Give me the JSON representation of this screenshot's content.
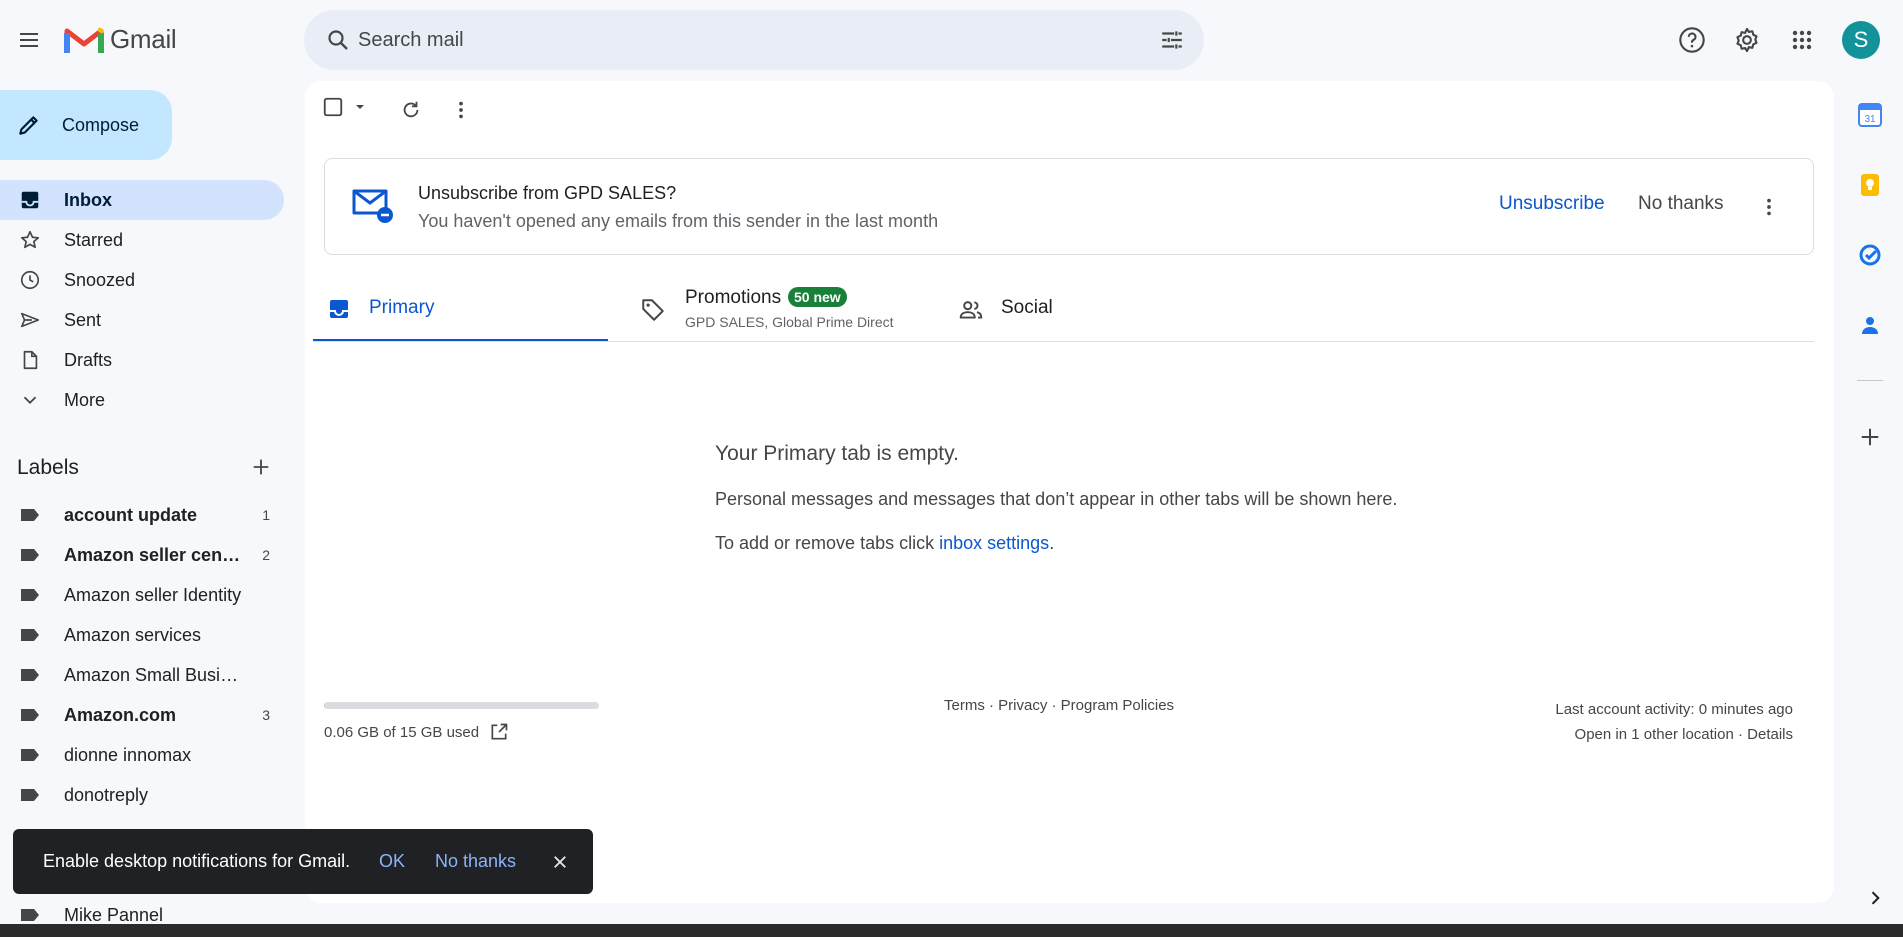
{
  "app": {
    "name": "Gmail"
  },
  "search": {
    "placeholder": "Search mail"
  },
  "user": {
    "initial": "S"
  },
  "compose": {
    "label": "Compose"
  },
  "nav": [
    {
      "label": "Inbox",
      "active": true
    },
    {
      "label": "Starred"
    },
    {
      "label": "Snoozed"
    },
    {
      "label": "Sent"
    },
    {
      "label": "Drafts"
    },
    {
      "label": "More"
    }
  ],
  "labels": {
    "title": "Labels",
    "items": [
      {
        "label": "account update",
        "count": "1",
        "bold": true
      },
      {
        "label": "Amazon seller cent…",
        "count": "2",
        "bold": true
      },
      {
        "label": "Amazon seller Identity",
        "count": ""
      },
      {
        "label": "Amazon services",
        "count": ""
      },
      {
        "label": "Amazon Small Business",
        "count": ""
      },
      {
        "label": "Amazon.com",
        "count": "3",
        "bold": true
      },
      {
        "label": "dionne innomax",
        "count": ""
      },
      {
        "label": "donotreply",
        "count": ""
      },
      {
        "label": "Mike Pannel",
        "count": ""
      }
    ]
  },
  "unsubscribe": {
    "title": "Unsubscribe from GPD SALES?",
    "subtitle": "You haven't opened any emails from this sender in the last month",
    "action": "Unsubscribe",
    "dismiss": "No thanks"
  },
  "tabs": {
    "primary": {
      "label": "Primary"
    },
    "promotions": {
      "label": "Promotions",
      "badge": "50 new",
      "senders": "GPD SALES, Global Prime Direct"
    },
    "social": {
      "label": "Social"
    }
  },
  "empty": {
    "title": "Your Primary tab is empty.",
    "message": "Personal messages and messages that don’t appear in other tabs will be shown here.",
    "settings_prefix": "To add or remove tabs click ",
    "settings_link": "inbox settings",
    "settings_suffix": "."
  },
  "storage": {
    "used_text": "0.06 GB of 15 GB used",
    "fraction": 0.004
  },
  "footer": {
    "links": "Terms · Privacy · Program Policies"
  },
  "activity": {
    "last": "Last account activity: 0 minutes ago",
    "other_location": "Open in 1 other location · Details"
  },
  "snackbar": {
    "text": "Enable desktop notifications for Gmail.",
    "ok": "OK",
    "no": "No thanks"
  },
  "side_apps": [
    "calendar-icon",
    "keep-icon",
    "tasks-icon",
    "contacts-icon"
  ],
  "colors": {
    "accent": "#0b57d0",
    "compose": "#c2e7ff",
    "active_nav": "#d3e3fd",
    "badge": "#188038",
    "avatar": "#12939a"
  }
}
